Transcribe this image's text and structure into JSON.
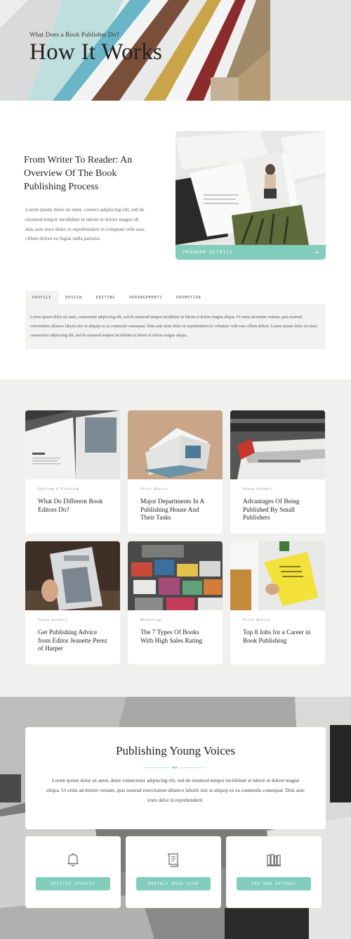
{
  "hero": {
    "kicker": "What Does a Book Publisher Do?",
    "title": "How It Works"
  },
  "intro": {
    "title": "From Writer To Reader: An Overview Of The Book Publishing Process",
    "body": "Lorem ipsum dolor sit amet, consect adipiscing elit, sed do eiusmod tempor incididunt ut labore et dolore magna ali duis aute irure dolor in reprehenderit in voluptate velit esse cillum dolore eu fugiat nulla pariatur.",
    "button_label": "PROGRAM DETAILS",
    "button_icon": "arrow-right-icon"
  },
  "tabs": {
    "items": [
      "PROFILE",
      "DESIGN",
      "EDITING",
      "ARRANGEMENTS",
      "PROMOTION"
    ],
    "active": "PROFILE",
    "content": "Lorem ipsum dolor sit amet, consectetur adipiscing elit, sed do eiusmod tempor incididunt ut labore et dolore magna aliqua. Ut enim ad minim veniam, quis nostrud exercitation ullamco laboris nisi ut aliquip ex ea commodo consequat. Duis aute irure dolor in reprehenderit in voluptate velit esse cillum dolore. Lorem ipsum dolor sit amet, consectetur adipiscing elit, sed do eiusmod tempor incididunt ut labore et dolore magna aliqua."
  },
  "articles": [
    {
      "category": "Editing & Planning",
      "title": "What Do Different Book Editors Do?"
    },
    {
      "category": "Print Basics",
      "title": "Major Departments In A Publishing House And Their Tasks"
    },
    {
      "category": "Young Authors",
      "title": "Advantages Of Being Published By Small Publishers"
    },
    {
      "category": "Young Authors",
      "title": "Get Publishing Advice from Editor Jeanette Perez of Harper"
    },
    {
      "category": "Marketing",
      "title": "The 7 Types Of Books With High Sales Rating"
    },
    {
      "category": "Print Basics",
      "title": "Top 8 Jobs for a Career in Book Publishing"
    }
  ],
  "voices": {
    "title": "Publishing Young Voices",
    "body": "Lorem ipsum dolor sit amet, dolor consectetur adipiscing elit, sed do eiusmod tempor incididunt ut labore et dolore magna aliqua. Ut enim ad minim veniam, quis nostrud exercitation ullamco laboris nisi ut aliquip ex ea commodo consequat. Duis aute irure dolor in reprehenderit."
  },
  "actions": [
    {
      "icon": "bell-icon",
      "label": "RECEIVE UPDATES"
    },
    {
      "icon": "scroll-icon",
      "label": "MONTHLY BOOK CLUB"
    },
    {
      "icon": "books-icon",
      "label": "FOR NEW AUTHORS"
    }
  ],
  "colors": {
    "accent": "#82cdbb",
    "section_gray": "#f0f0ee",
    "tab_panel": "#f2f2f0"
  }
}
